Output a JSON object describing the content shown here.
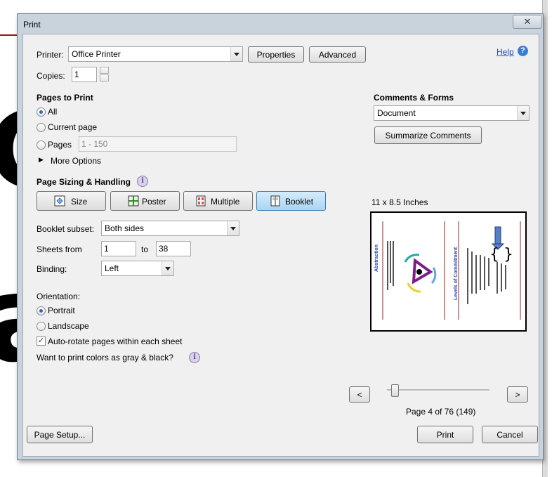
{
  "background": {
    "glyph_top": "C",
    "glyph_bottom": "a"
  },
  "dialog": {
    "title": "Print",
    "close_label": "✕"
  },
  "printer": {
    "label": "Printer:",
    "selected": "Office Printer",
    "properties_label": "Properties",
    "advanced_label": "Advanced",
    "help_label": "Help"
  },
  "copies": {
    "label": "Copies:",
    "value": "1"
  },
  "pages_to_print": {
    "heading": "Pages to Print",
    "all_label": "All",
    "current_label": "Current page",
    "pages_label": "Pages",
    "pages_placeholder": "1 - 150",
    "more_options_label": "More Options"
  },
  "sizing": {
    "heading": "Page Sizing & Handling",
    "buttons": [
      "Size",
      "Poster",
      "Multiple",
      "Booklet"
    ],
    "active": "Booklet"
  },
  "booklet": {
    "subset_label": "Booklet subset:",
    "subset_value": "Both sides",
    "sheets_label": "Sheets from",
    "sheets_from": "1",
    "to_label": "to",
    "sheets_to": "38",
    "binding_label": "Binding:",
    "binding_value": "Left"
  },
  "orientation": {
    "heading": "Orientation:",
    "portrait_label": "Portrait",
    "landscape_label": "Landscape",
    "selected": "Portrait",
    "autorotate_label": "Auto-rotate pages within each sheet",
    "autorotate_checked": true,
    "gray_question": "Want to print colors as gray & black?"
  },
  "comments_forms": {
    "heading": "Comments & Forms",
    "selected": "Document",
    "summarize_label": "Summarize Comments"
  },
  "preview": {
    "size_label": "11 x 8.5 Inches",
    "left_page_title": "Abstraction",
    "right_page_title": "Levels of Commitment",
    "page_info": "Page 4 of 76 (149)",
    "prev_label": "<",
    "next_label": ">"
  },
  "footer": {
    "page_setup_label": "Page Setup...",
    "print_label": "Print",
    "cancel_label": "Cancel"
  },
  "colors": {
    "accent": "#2a6dbf",
    "active_button": "#a9d5f2",
    "link": "#1a4fb5",
    "preview_rule": "#9a1f2a"
  }
}
